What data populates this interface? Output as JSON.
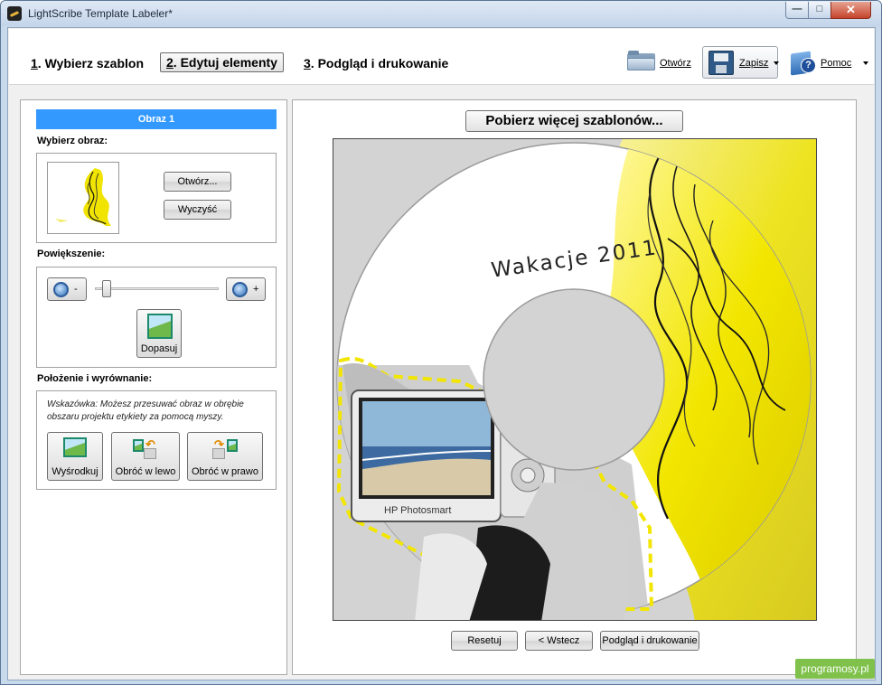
{
  "window": {
    "title": "LightScribe Template Labeler*"
  },
  "steps": [
    {
      "num": "1",
      "label": ". Wybierz szablon"
    },
    {
      "num": "2",
      "label": ". Edytuj elementy"
    },
    {
      "num": "3",
      "label": ". Podgląd i drukowanie"
    }
  ],
  "toolbar": {
    "open_label": "Otwórz",
    "save_label": "Zapisz",
    "help_label": "Pomoc"
  },
  "left": {
    "header": "Obraz 1",
    "choose_image_label": "Wybierz obraz:",
    "open_button": "Otwórz...",
    "clear_button": "Wyczyść",
    "zoom_label": "Powiększenie:",
    "zoom_minus": "-",
    "zoom_plus": "+",
    "zoom_level": 0.06,
    "fit_button": "Dopasuj",
    "position_label": "Położenie i wyrównanie:",
    "hint": "Wskazówka: Możesz przesuwać obraz w obrębie obszaru projektu etykiety za pomocą myszy.",
    "center_button": "Wyśrodkuj",
    "rotate_left_button": "Obróć w lewo",
    "rotate_right_button": "Obróć w prawo"
  },
  "right": {
    "more_templates_button": "Pobierz więcej szablonów...",
    "label_text": "Wakacje 2011",
    "camera_text": "HP Photosmart",
    "reset_button": "Resetuj",
    "back_button": "< Wstecz",
    "preview_button": "Podgląd i drukowanie"
  },
  "watermark": "programosy.pl",
  "colors": {
    "accent": "#3399ff",
    "highlight": "#f2e600"
  }
}
